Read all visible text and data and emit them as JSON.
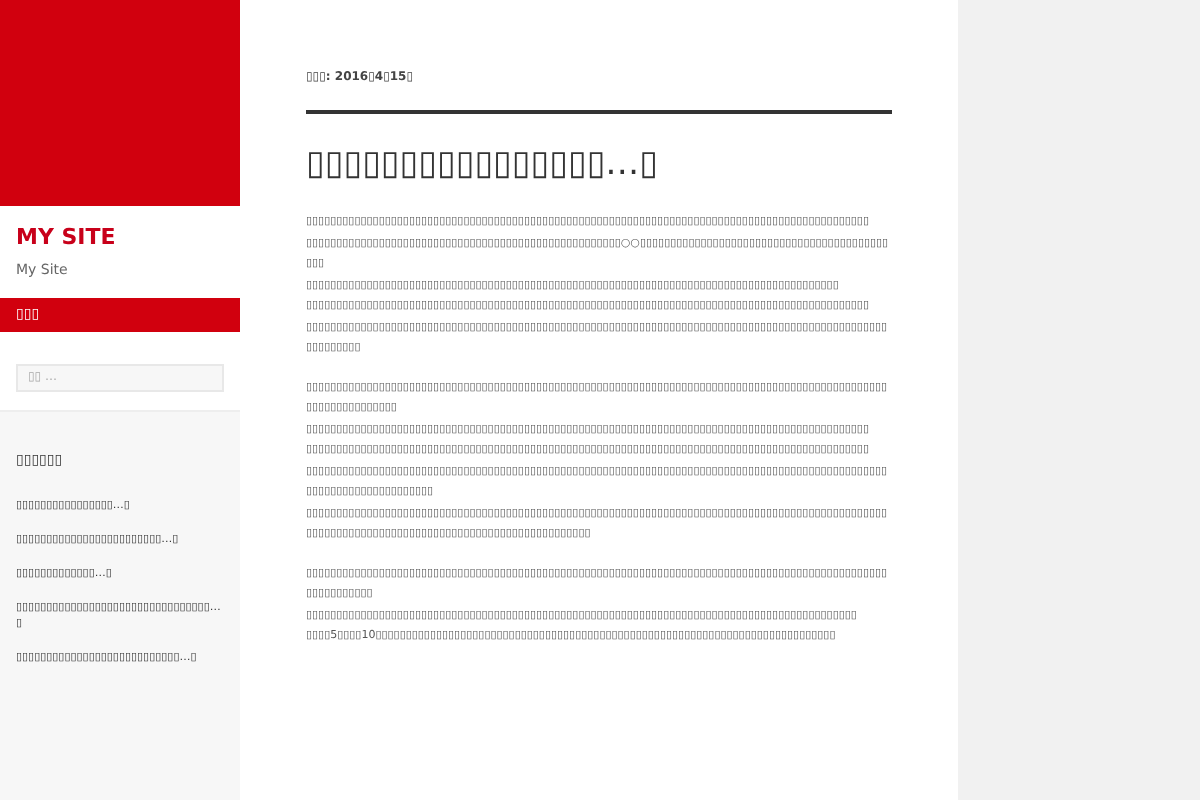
{
  "sidebar": {
    "site_title": "MY SITE",
    "tagline": "My Site",
    "menu_items": [
      {
        "label": "▯▯▯",
        "selected": true
      }
    ],
    "search": {
      "placeholder": "▯▯ …"
    },
    "widget": {
      "title": "▯▯▯▯▯▯",
      "items": [
        "▯▯▯▯▯▯▯▯▯▯▯▯▯▯▯▯…▯",
        "▯▯▯▯▯▯▯▯▯▯▯▯▯▯▯▯▯▯▯▯▯▯▯▯…▯",
        "▯▯▯▯▯▯▯▯▯▯▯▯▯…▯",
        "▯▯▯▯▯▯▯▯▯▯▯▯▯▯▯▯▯▯▯▯▯▯▯▯▯▯▯▯▯▯▯▯…▯",
        "▯▯▯▯▯▯▯▯▯▯▯▯▯▯▯▯▯▯▯▯▯▯▯▯▯▯▯…▯"
      ]
    }
  },
  "post": {
    "meta": "▯▯▯: 2016▯4▯15▯",
    "title": "▯▯▯▯▯▯▯▯▯▯▯▯▯▯▯▯…▯",
    "paragraphs": [
      [
        "▯▯▯▯▯▯▯▯▯▯▯▯▯▯▯▯▯▯▯▯▯▯▯▯▯▯▯▯▯▯▯▯▯▯▯▯▯▯▯▯▯▯▯▯▯▯▯▯▯▯▯▯▯▯▯▯▯▯▯▯▯▯▯▯▯▯▯▯▯▯▯▯▯▯▯▯▯▯▯▯▯▯▯▯▯▯▯▯▯▯▯▯▯",
        "▯▯▯▯▯▯▯▯▯▯▯▯▯▯▯▯▯▯▯▯▯▯▯▯▯▯▯▯▯▯▯▯▯▯▯▯▯▯▯▯▯▯▯▯▯▯▯▯▯▯▯▯○○▯▯▯▯▯▯▯▯▯▯▯▯▯▯▯▯▯▯▯▯▯▯▯▯▯▯▯▯▯▯▯▯▯▯▯▯▯▯▯▯▯▯▯▯",
        "▯▯▯▯▯▯▯▯▯▯▯▯▯▯▯▯▯▯▯▯▯▯▯▯▯▯▯▯▯▯▯▯▯▯▯▯▯▯▯▯▯▯▯▯▯▯▯▯▯▯▯▯▯▯▯▯▯▯▯▯▯▯▯▯▯▯▯▯▯▯▯▯▯▯▯▯▯▯▯▯▯▯▯▯▯▯▯▯",
        "▯▯▯▯▯▯▯▯▯▯▯▯▯▯▯▯▯▯▯▯▯▯▯▯▯▯▯▯▯▯▯▯▯▯▯▯▯▯▯▯▯▯▯▯▯▯▯▯▯▯▯▯▯▯▯▯▯▯▯▯▯▯▯▯▯▯▯▯▯▯▯▯▯▯▯▯▯▯▯▯▯▯▯▯▯▯▯▯▯▯▯▯▯",
        "▯▯▯▯▯▯▯▯▯▯▯▯▯▯▯▯▯▯▯▯▯▯▯▯▯▯▯▯▯▯▯▯▯▯▯▯▯▯▯▯▯▯▯▯▯▯▯▯▯▯▯▯▯▯▯▯▯▯▯▯▯▯▯▯▯▯▯▯▯▯▯▯▯▯▯▯▯▯▯▯▯▯▯▯▯▯▯▯▯▯▯▯▯▯▯▯▯▯▯▯▯▯▯▯▯"
      ],
      [
        "▯▯▯▯▯▯▯▯▯▯▯▯▯▯▯▯▯▯▯▯▯▯▯▯▯▯▯▯▯▯▯▯▯▯▯▯▯▯▯▯▯▯▯▯▯▯▯▯▯▯▯▯▯▯▯▯▯▯▯▯▯▯▯▯▯▯▯▯▯▯▯▯▯▯▯▯▯▯▯▯▯▯▯▯▯▯▯▯▯▯▯▯▯▯▯▯▯▯▯▯▯▯▯▯▯▯▯▯▯▯▯",
        "▯▯▯▯▯▯▯▯▯▯▯▯▯▯▯▯▯▯▯▯▯▯▯▯▯▯▯▯▯▯▯▯▯▯▯▯▯▯▯▯▯▯▯▯▯▯▯▯▯▯▯▯▯▯▯▯▯▯▯▯▯▯▯▯▯▯▯▯▯▯▯▯▯▯▯▯▯▯▯▯▯▯▯▯▯▯▯▯▯▯▯▯▯",
        "▯▯▯▯▯▯▯▯▯▯▯▯▯▯▯▯▯▯▯▯▯▯▯▯▯▯▯▯▯▯▯▯▯▯▯▯▯▯▯▯▯▯▯▯▯▯▯▯▯▯▯▯▯▯▯▯▯▯▯▯▯▯▯▯▯▯▯▯▯▯▯▯▯▯▯▯▯▯▯▯▯▯▯▯▯▯▯▯▯▯▯▯▯",
        "▯▯▯▯▯▯▯▯▯▯▯▯▯▯▯▯▯▯▯▯▯▯▯▯▯▯▯▯▯▯▯▯▯▯▯▯▯▯▯▯▯▯▯▯▯▯▯▯▯▯▯▯▯▯▯▯▯▯▯▯▯▯▯▯▯▯▯▯▯▯▯▯▯▯▯▯▯▯▯▯▯▯▯▯▯▯▯▯▯▯▯▯▯▯▯▯▯▯▯▯▯▯▯▯▯▯▯▯▯▯▯▯▯▯▯▯▯",
        "▯▯▯▯▯▯▯▯▯▯▯▯▯▯▯▯▯▯▯▯▯▯▯▯▯▯▯▯▯▯▯▯▯▯▯▯▯▯▯▯▯▯▯▯▯▯▯▯▯▯▯▯▯▯▯▯▯▯▯▯▯▯▯▯▯▯▯▯▯▯▯▯▯▯▯▯▯▯▯▯▯▯▯▯▯▯▯▯▯▯▯▯▯▯▯▯▯▯▯▯▯▯▯▯▯▯▯▯▯▯▯▯▯▯▯▯▯▯▯▯▯▯▯▯▯▯▯▯▯▯▯▯▯▯▯▯▯▯▯▯▯▯▯"
      ],
      [
        "▯▯▯▯▯▯▯▯▯▯▯▯▯▯▯▯▯▯▯▯▯▯▯▯▯▯▯▯▯▯▯▯▯▯▯▯▯▯▯▯▯▯▯▯▯▯▯▯▯▯▯▯▯▯▯▯▯▯▯▯▯▯▯▯▯▯▯▯▯▯▯▯▯▯▯▯▯▯▯▯▯▯▯▯▯▯▯▯▯▯▯▯▯▯▯▯▯▯▯▯▯▯▯▯▯▯▯",
        "▯▯▯▯▯▯▯▯▯▯▯▯▯▯▯▯▯▯▯▯▯▯▯▯▯▯▯▯▯▯▯▯▯▯▯▯▯▯▯▯▯▯▯▯▯▯▯▯▯▯▯▯▯▯▯▯▯▯▯▯▯▯▯▯▯▯▯▯▯▯▯▯▯▯▯▯▯▯▯▯▯▯▯▯▯▯▯▯▯▯▯",
        "▯▯▯▯5▯▯▯▯10▯▯▯▯▯▯▯▯▯▯▯▯▯▯▯▯▯▯▯▯▯▯▯▯▯▯▯▯▯▯▯▯▯▯▯▯▯▯▯▯▯▯▯▯▯▯▯▯▯▯▯▯▯▯▯▯▯▯▯▯▯▯▯▯▯▯▯▯▯▯▯▯▯▯▯▯"
      ]
    ]
  }
}
